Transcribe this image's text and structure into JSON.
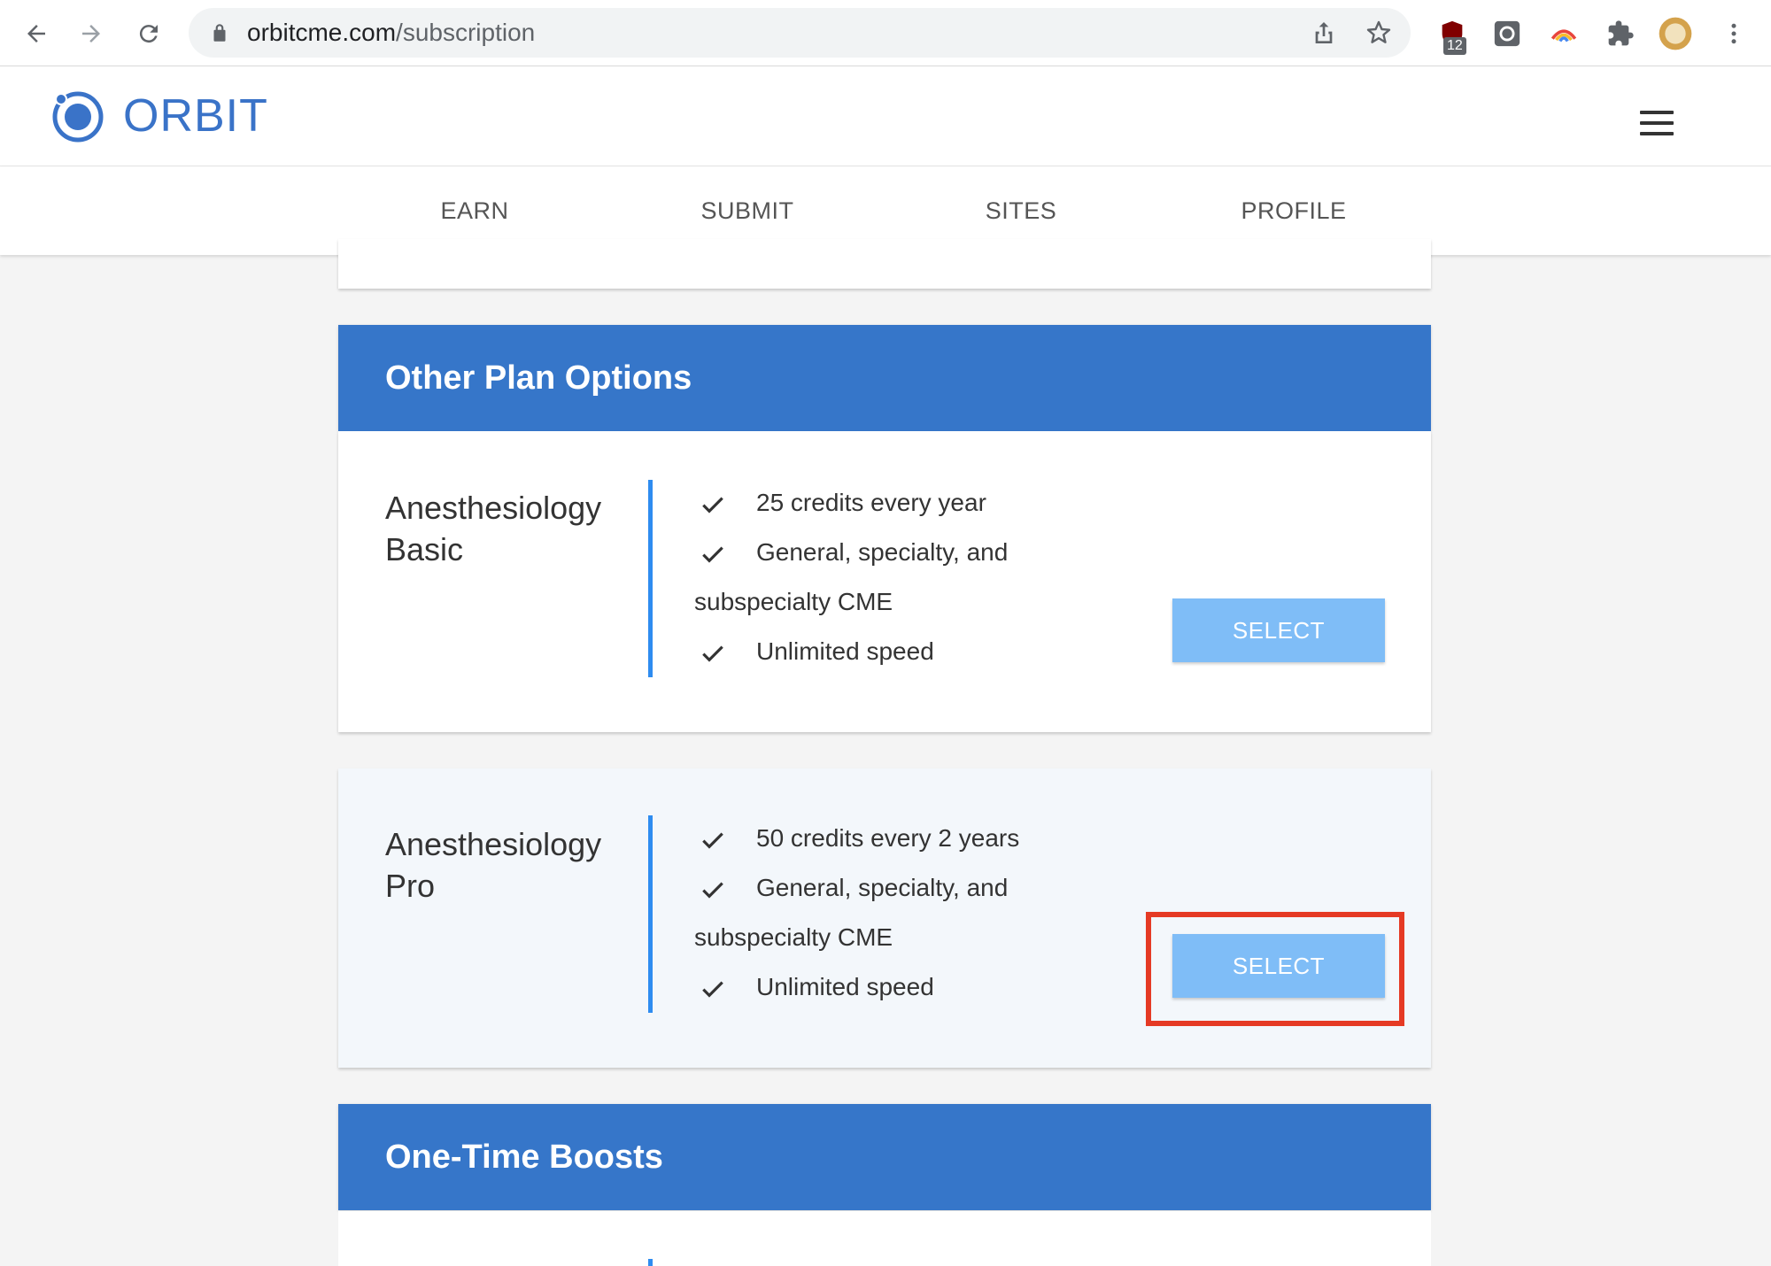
{
  "browser": {
    "url_domain": "orbitcme.com",
    "url_path": "/subscription",
    "extension_badge": "12"
  },
  "app": {
    "logo_text": "ORBIT"
  },
  "tabs": [
    {
      "label": "EARN"
    },
    {
      "label": "SUBMIT"
    },
    {
      "label": "SITES"
    },
    {
      "label": "PROFILE"
    }
  ],
  "sections": {
    "other_plans_title": "Other Plan Options",
    "boosts_title": "One-Time Boosts"
  },
  "plans": [
    {
      "name_line1": "Anesthesiology",
      "name_line2": "Basic",
      "features": [
        "25 credits every year",
        "General, specialty, and",
        "subspecialty CME",
        "Unlimited speed"
      ],
      "button": "SELECT"
    },
    {
      "name_line1": "Anesthesiology",
      "name_line2": "Pro",
      "features": [
        "50 credits every 2 years",
        "General, specialty, and",
        "subspecialty CME",
        "Unlimited speed"
      ],
      "button": "SELECT"
    }
  ],
  "colors": {
    "brand_blue": "#3676c9",
    "button_blue": "#7fbdf7",
    "divider_blue": "#2e8cf0",
    "highlight_red": "#e53a24"
  }
}
